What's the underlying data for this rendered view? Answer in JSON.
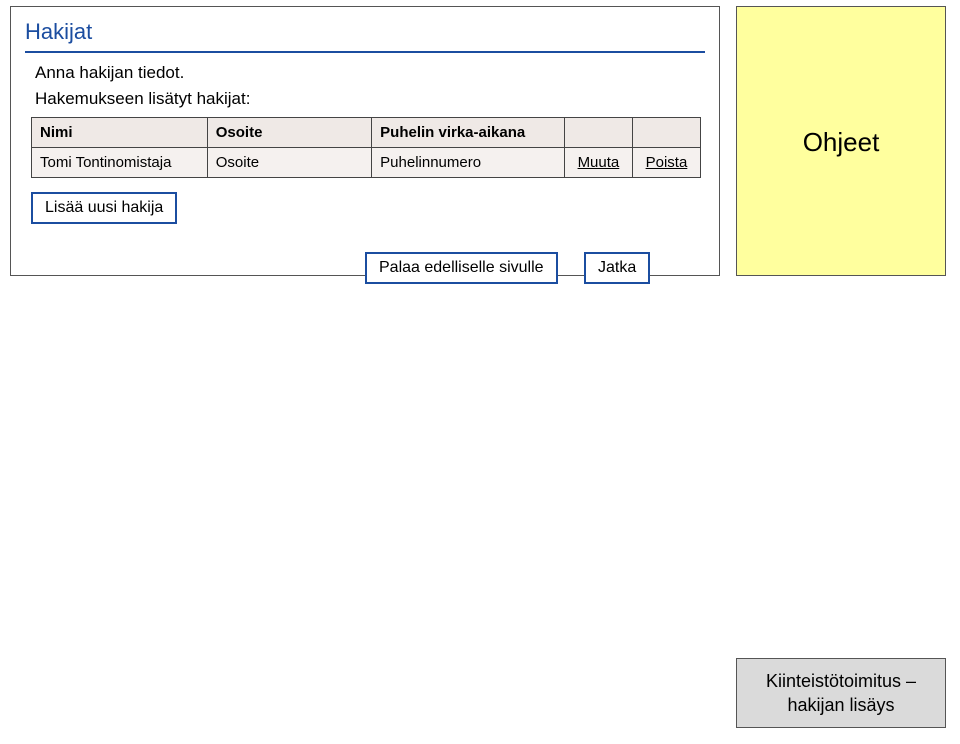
{
  "main": {
    "title": "Hakijat",
    "instruction": "Anna hakijan tiedot.",
    "subhead": "Hakemukseen lisätyt hakijat:",
    "table": {
      "headers": {
        "name": "Nimi",
        "address": "Osoite",
        "phone": "Puhelin virka-aikana"
      },
      "row": {
        "name": "Tomi Tontinomistaja",
        "address": "Osoite",
        "phone": "Puhelinnumero",
        "edit": "Muuta",
        "delete": "Poista"
      }
    },
    "buttons": {
      "add": "Lisää uusi hakija",
      "back": "Palaa edelliselle sivulle",
      "next": "Jatka"
    }
  },
  "side": {
    "help": "Ohjeet"
  },
  "caption": {
    "line1": "Kiinteistötoimitus –",
    "line2": "hakijan lisäys"
  }
}
